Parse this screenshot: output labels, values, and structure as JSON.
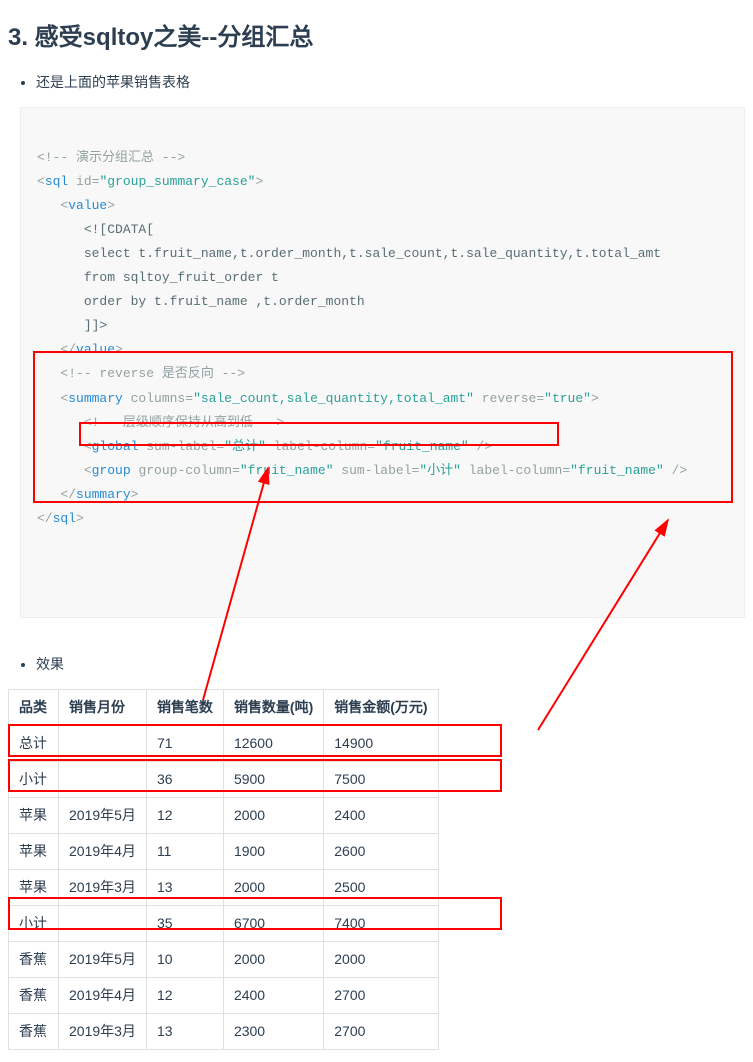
{
  "heading": "3. 感受sqltoy之美--分组汇总",
  "bullet1": "还是上面的苹果销售表格",
  "bullet2": "效果",
  "code": {
    "l1a": "<!-- 演示分组汇总 -->",
    "l2a": "<",
    "l2b": "sql",
    "l2c": " id",
    "l2d": "=",
    "l2e": "\"group_summary_case\"",
    "l2f": ">",
    "l3a": "<",
    "l3b": "value",
    "l3c": ">",
    "l4": "<![CDATA[",
    "l5": "select t.fruit_name,t.order_month,t.sale_count,t.sale_quantity,t.total_amt",
    "l6": "from sqltoy_fruit_order t",
    "l7": "order by t.fruit_name ,t.order_month",
    "l8": "]]>",
    "l9a": "</",
    "l9b": "value",
    "l9c": ">",
    "l10": "<!-- reverse 是否反向 -->",
    "l11a": "<",
    "l11b": "summary",
    "l11c": " columns",
    "l11d": "=",
    "l11e": "\"sale_count,sale_quantity,total_amt\"",
    "l11f": " reverse",
    "l11g": "=",
    "l11h": "\"true\"",
    "l11i": ">",
    "l12": "<!-- 层级顺序保持从高到低 -->",
    "l13a": "<",
    "l13b": "global",
    "l13c": " sum-label",
    "l13d": "=",
    "l13e": "\"总计\"",
    "l13f": " label-column",
    "l13g": "=",
    "l13h": "\"fruit_name\"",
    "l13i": " />",
    "l14a": "<",
    "l14b": "group",
    "l14c": " group-column",
    "l14d": "=",
    "l14e": "\"fruit_name\"",
    "l14f": " sum-label",
    "l14g": "=",
    "l14h": "\"小计\"",
    "l14i": " label-column",
    "l14j": "=",
    "l14k": "\"fruit_name\"",
    "l14l": " />",
    "l15a": "</",
    "l15b": "summary",
    "l15c": ">",
    "l16a": "</",
    "l16b": "sql",
    "l16c": ">"
  },
  "table": {
    "headers": [
      "品类",
      "销售月份",
      "销售笔数",
      "销售数量(吨)",
      "销售金额(万元)"
    ],
    "rows": [
      [
        "总计",
        "",
        "71",
        "12600",
        "14900"
      ],
      [
        "小计",
        "",
        "36",
        "5900",
        "7500"
      ],
      [
        "苹果",
        "2019年5月",
        "12",
        "2000",
        "2400"
      ],
      [
        "苹果",
        "2019年4月",
        "11",
        "1900",
        "2600"
      ],
      [
        "苹果",
        "2019年3月",
        "13",
        "2000",
        "2500"
      ],
      [
        "小计",
        "",
        "35",
        "6700",
        "7400"
      ],
      [
        "香蕉",
        "2019年5月",
        "10",
        "2000",
        "2000"
      ],
      [
        "香蕉",
        "2019年4月",
        "12",
        "2400",
        "2700"
      ],
      [
        "香蕉",
        "2019年3月",
        "13",
        "2300",
        "2700"
      ]
    ]
  }
}
